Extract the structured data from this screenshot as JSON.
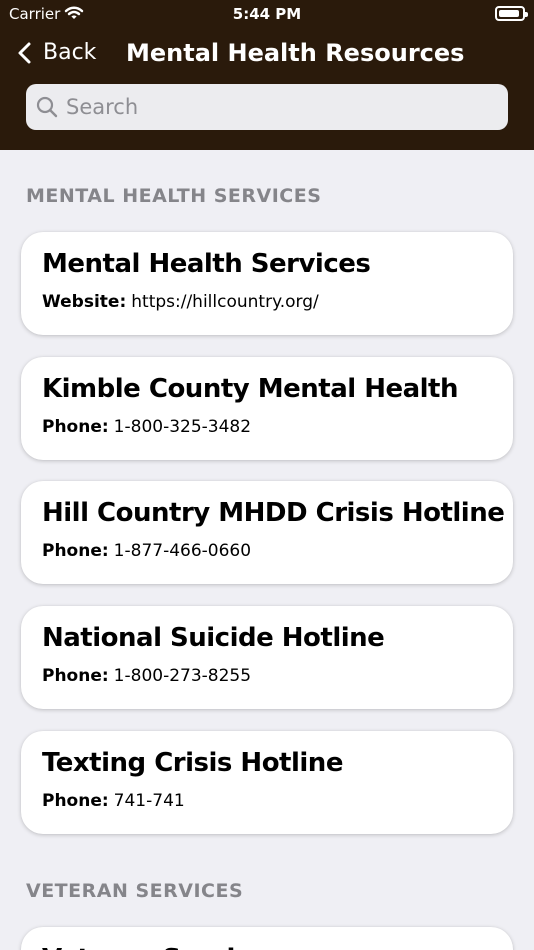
{
  "status_bar": {
    "carrier": "Carrier",
    "time": "5:44 PM",
    "wifi_icon": "wifi-icon",
    "battery_icon": "battery-icon"
  },
  "header": {
    "back_label": "Back",
    "title": "Mental Health Resources",
    "background_color": "#2a1a0b",
    "text_color": "#ffffff"
  },
  "search": {
    "placeholder": "Search",
    "icon": "search-icon",
    "value": ""
  },
  "sections": [
    {
      "header": "MENTAL HEALTH SERVICES",
      "cards": [
        {
          "title": "Mental Health Services",
          "detail_label": "Website:",
          "detail_value": "https://hillcountry.org/"
        },
        {
          "title": "Kimble County Mental Health",
          "detail_label": "Phone:",
          "detail_value": "1-800-325-3482"
        },
        {
          "title": "Hill Country MHDD Crisis Hotline",
          "detail_label": "Phone:",
          "detail_value": "1-877-466-0660"
        },
        {
          "title": "National Suicide Hotline",
          "detail_label": "Phone:",
          "detail_value": "1-800-273-8255"
        },
        {
          "title": "Texting Crisis Hotline",
          "detail_label": "Phone:",
          "detail_value": "741-741"
        }
      ]
    },
    {
      "header": "VETERAN SERVICES",
      "cards": [
        {
          "title": "Veteran Services"
        }
      ]
    }
  ],
  "colors": {
    "page_background": "#efeff4",
    "card_background": "#ffffff",
    "section_header": "#85858a"
  }
}
